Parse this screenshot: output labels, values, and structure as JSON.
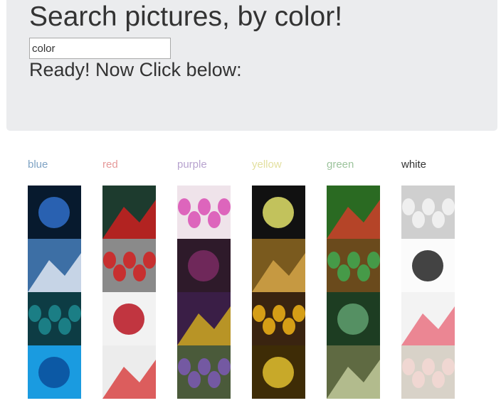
{
  "header": {
    "title": "Search pictures, by color!",
    "search_value": "color",
    "status": "Ready! Now Click below:"
  },
  "columns": [
    {
      "label": "blue",
      "label_color": "#7fa3c4",
      "thumbs": [
        {
          "icon": "night-tunnel-photo",
          "bg": "#071a2e",
          "accent": "#2f6fc8"
        },
        {
          "icon": "mountain-lake-photo",
          "bg": "#3d6fa5",
          "accent": "#e8eef6"
        },
        {
          "icon": "silhouette-door-photo",
          "bg": "#0d3c44",
          "accent": "#1e8a90"
        },
        {
          "icon": "blue-mandala-photo",
          "bg": "#1a9be0",
          "accent": "#0a4e9a"
        }
      ]
    },
    {
      "label": "red",
      "label_color": "#e69a9a",
      "thumbs": [
        {
          "icon": "red-vinyl-record-photo",
          "bg": "#1d3b2e",
          "accent": "#d81e1e"
        },
        {
          "icon": "ladybug-photo",
          "bg": "#8a8a8a",
          "accent": "#d12020"
        },
        {
          "icon": "raspberries-photo",
          "bg": "#f2f2f2",
          "accent": "#b81421"
        },
        {
          "icon": "snail-on-clip-photo",
          "bg": "#ececec",
          "accent": "#d83a3a"
        }
      ]
    },
    {
      "label": "purple",
      "label_color": "#b8a3cf",
      "thumbs": [
        {
          "icon": "nail-polish-photo",
          "bg": "#efe3ea",
          "accent": "#d94fb4"
        },
        {
          "icon": "purple-tulips-photo",
          "bg": "#2e1a2a",
          "accent": "#7a2b63"
        },
        {
          "icon": "yellow-leaf-droplet-photo",
          "bg": "#3a1e46",
          "accent": "#d8b21e"
        },
        {
          "icon": "purple-flowers-photo",
          "bg": "#4a5a3a",
          "accent": "#7b59b5"
        }
      ]
    },
    {
      "label": "yellow",
      "label_color": "#e3e0a0",
      "thumbs": [
        {
          "icon": "yellow-light-silhouette-photo",
          "bg": "#111111",
          "accent": "#e2e26a"
        },
        {
          "icon": "golden-bud-photo",
          "bg": "#7a5a1e",
          "accent": "#d9a94a"
        },
        {
          "icon": "yellow-flower-bouquet-photo",
          "bg": "#3a2410",
          "accent": "#f1b418"
        },
        {
          "icon": "yellow-corridor-photo",
          "bg": "#3e2c06",
          "accent": "#e0c030"
        }
      ]
    },
    {
      "label": "green",
      "label_color": "#9dc49d",
      "thumbs": [
        {
          "icon": "green-beads-photo",
          "bg": "#2a6a22",
          "accent": "#d83b2a"
        },
        {
          "icon": "green-eye-face-photo",
          "bg": "#6a4a1c",
          "accent": "#3fa850"
        },
        {
          "icon": "forest-lake-photo",
          "bg": "#1d3d22",
          "accent": "#5f9f6f"
        },
        {
          "icon": "dandelion-photo",
          "bg": "#5f6a42",
          "accent": "#c7d0a0"
        }
      ]
    },
    {
      "label": "white",
      "label_color": "#333333",
      "thumbs": [
        {
          "icon": "white-objects-photo",
          "bg": "#cfcfcf",
          "accent": "#f4f4f4"
        },
        {
          "icon": "white-bridge-photo",
          "bg": "#fbfbfb",
          "accent": "#222222"
        },
        {
          "icon": "pencils-photo",
          "bg": "#f3f3f3",
          "accent": "#e86a7a"
        },
        {
          "icon": "white-rose-photo",
          "bg": "#d8d2c8",
          "accent": "#f5d8d3"
        }
      ]
    }
  ]
}
